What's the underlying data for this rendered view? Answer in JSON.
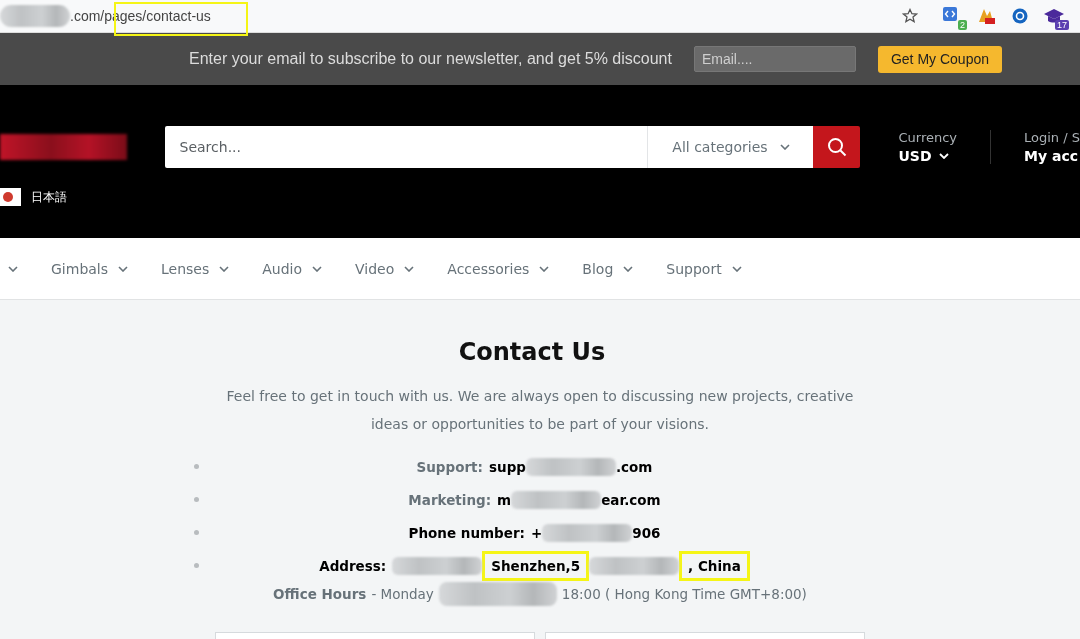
{
  "browser": {
    "url_visible": ".com/pages/contact-us",
    "extensions": [
      {
        "kind": "code",
        "badge": "2"
      },
      {
        "kind": "pro"
      },
      {
        "kind": "circle"
      },
      {
        "kind": "cap",
        "badge": "17"
      }
    ]
  },
  "newsletter": {
    "text": "Enter your email to subscribe to our newsletter, and get 5% discount",
    "placeholder": "Email....",
    "button": "Get My Coupon"
  },
  "header": {
    "search_placeholder": "Search...",
    "category": "All categories",
    "currency_label": "Currency",
    "currency": "USD",
    "login_label": "Login / S",
    "account": "My acc",
    "language": "日本語"
  },
  "nav": [
    {
      "kind": "cut"
    },
    {
      "kind": "menu",
      "label": "Gimbals"
    },
    {
      "kind": "menu",
      "label": "Lenses"
    },
    {
      "kind": "menu",
      "label": "Audio"
    },
    {
      "kind": "menu",
      "label": "Video"
    },
    {
      "kind": "menu",
      "label": "Accessories"
    },
    {
      "kind": "menu",
      "label": "Blog"
    },
    {
      "kind": "menu",
      "label": "Support"
    }
  ],
  "contact": {
    "title": "Contact Us",
    "intro": "Feel free to get in touch with us. We are always open to discussing new projects, creative ideas or opportunities to be part of your visions.",
    "rows": [
      {
        "label": "Support:",
        "label_muted": true,
        "parts": [
          {
            "kind": "text",
            "text": "supp"
          },
          {
            "kind": "blur"
          },
          {
            "kind": "text",
            "text": ".com"
          }
        ]
      },
      {
        "label": "Marketing:",
        "label_muted": true,
        "parts": [
          {
            "kind": "text",
            "text": "m"
          },
          {
            "kind": "blur"
          },
          {
            "kind": "text",
            "text": "ear.com"
          }
        ]
      },
      {
        "label": "Phone number:",
        "label_muted": false,
        "parts": [
          {
            "kind": "text",
            "text": "+"
          },
          {
            "kind": "blur"
          },
          {
            "kind": "text",
            "text": "906"
          }
        ]
      },
      {
        "label": "Address:",
        "label_muted": false,
        "parts": [
          {
            "kind": "blur"
          },
          {
            "kind": "text",
            "text": "Shenzhen,5",
            "highlighted": true
          },
          {
            "kind": "blur"
          },
          {
            "kind": "text",
            "text": ", China",
            "highlighted": true
          }
        ]
      }
    ],
    "hours_label": "Office Hours",
    "hours_start": "- Monday",
    "hours_end": "18:00 ( Hong Kong Time GMT+8:00)"
  }
}
